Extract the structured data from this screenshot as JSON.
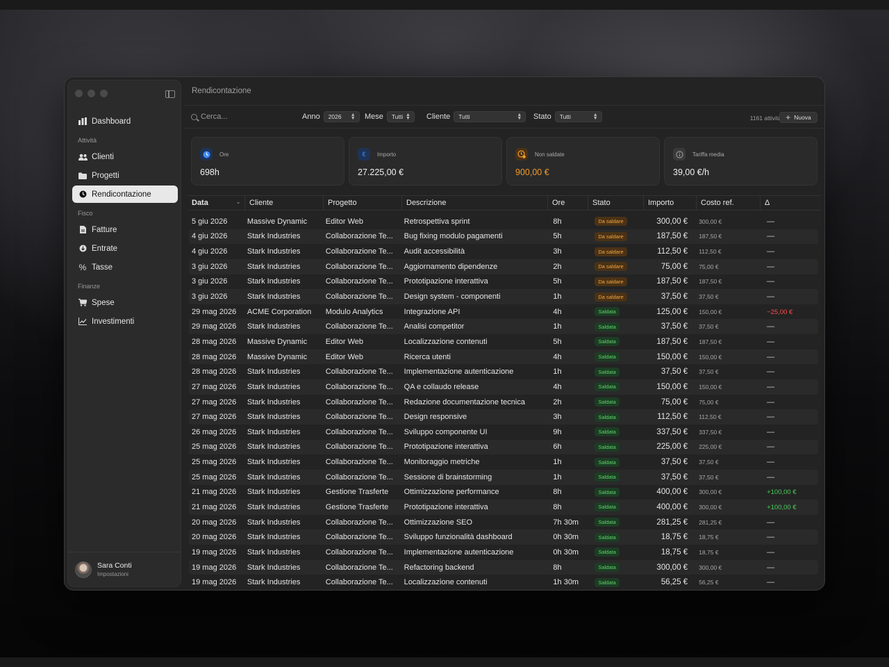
{
  "window": {
    "title": "Rendicontazione"
  },
  "sidebar": {
    "top_item": {
      "label": "Dashboard",
      "icon": "chart-bar-icon"
    },
    "sections": [
      {
        "title": "Attività",
        "items": [
          {
            "label": "Clienti",
            "icon": "users-icon",
            "active": false
          },
          {
            "label": "Progetti",
            "icon": "folder-icon",
            "active": false
          },
          {
            "label": "Rendicontazione",
            "icon": "clock-icon",
            "active": true
          }
        ]
      },
      {
        "title": "Fisco",
        "items": [
          {
            "label": "Fatture",
            "icon": "document-icon",
            "active": false
          },
          {
            "label": "Entrate",
            "icon": "arrow-down-circle-icon",
            "active": false
          },
          {
            "label": "Tasse",
            "icon": "percent-icon",
            "active": false
          }
        ]
      },
      {
        "title": "Finanze",
        "items": [
          {
            "label": "Spese",
            "icon": "cart-icon",
            "active": false
          },
          {
            "label": "Investimenti",
            "icon": "line-chart-icon",
            "active": false
          }
        ]
      }
    ],
    "user": {
      "name": "Sara Conti",
      "subtitle": "Impostazioni"
    }
  },
  "toolbar": {
    "search_placeholder": "Cerca...",
    "filters": {
      "anno": {
        "label": "Anno",
        "value": "2026"
      },
      "mese": {
        "label": "Mese",
        "value": "Tutti"
      },
      "cliente": {
        "label": "Cliente",
        "value": "Tutti"
      },
      "stato": {
        "label": "Stato",
        "value": "Tutti"
      }
    },
    "count": "1161 attività",
    "new_label": "Nuova"
  },
  "cards": [
    {
      "label": "Ore",
      "value": "698h",
      "icon": "clock-icon",
      "accent": "#3d8bff"
    },
    {
      "label": "Importo",
      "value": "27.225,00 €",
      "icon": "euro-icon",
      "accent": "#3d8bff"
    },
    {
      "label": "Non saldate",
      "value": "900,00 €",
      "icon": "clock-warning-icon",
      "accent": "#f39b2a"
    },
    {
      "label": "Tariffa media",
      "value": "39,00 €/h",
      "icon": "info-icon",
      "accent": "#9a9a9a"
    }
  ],
  "table": {
    "columns": [
      "Data",
      "Cliente",
      "Progetto",
      "Descrizione",
      "Ore",
      "Stato",
      "Importo",
      "Costo ref.",
      "Δ"
    ],
    "rows": [
      [
        "5 giu 2026",
        "Massive Dynamic",
        "Editor Web",
        "Retrospettiva sprint",
        "8h",
        "Da saldare",
        "300,00 €",
        "300,00 €",
        "—"
      ],
      [
        "4 giu 2026",
        "Stark Industries",
        "Collaborazione Te...",
        "Bug fixing modulo pagamenti",
        "5h",
        "Da saldare",
        "187,50 €",
        "187,50 €",
        "—"
      ],
      [
        "4 giu 2026",
        "Stark Industries",
        "Collaborazione Te...",
        "Audit accessibilità",
        "3h",
        "Da saldare",
        "112,50 €",
        "112,50 €",
        "—"
      ],
      [
        "3 giu 2026",
        "Stark Industries",
        "Collaborazione Te...",
        "Aggiornamento dipendenze",
        "2h",
        "Da saldare",
        "75,00 €",
        "75,00 €",
        "—"
      ],
      [
        "3 giu 2026",
        "Stark Industries",
        "Collaborazione Te...",
        "Prototipazione interattiva",
        "5h",
        "Da saldare",
        "187,50 €",
        "187,50 €",
        "—"
      ],
      [
        "3 giu 2026",
        "Stark Industries",
        "Collaborazione Te...",
        "Design system - componenti",
        "1h",
        "Da saldare",
        "37,50 €",
        "37,50 €",
        "—"
      ],
      [
        "29 mag 2026",
        "ACME Corporation",
        "Modulo Analytics",
        "Integrazione API",
        "4h",
        "Saldata",
        "125,00 €",
        "150,00 €",
        "−25,00 €"
      ],
      [
        "29 mag 2026",
        "Stark Industries",
        "Collaborazione Te...",
        "Analisi competitor",
        "1h",
        "Saldata",
        "37,50 €",
        "37,50 €",
        "—"
      ],
      [
        "28 mag 2026",
        "Massive Dynamic",
        "Editor Web",
        "Localizzazione contenuti",
        "5h",
        "Saldata",
        "187,50 €",
        "187,50 €",
        "—"
      ],
      [
        "28 mag 2026",
        "Massive Dynamic",
        "Editor Web",
        "Ricerca utenti",
        "4h",
        "Saldata",
        "150,00 €",
        "150,00 €",
        "—"
      ],
      [
        "28 mag 2026",
        "Stark Industries",
        "Collaborazione Te...",
        "Implementazione autenticazione",
        "1h",
        "Saldata",
        "37,50 €",
        "37,50 €",
        "—"
      ],
      [
        "27 mag 2026",
        "Stark Industries",
        "Collaborazione Te...",
        "QA e collaudo release",
        "4h",
        "Saldata",
        "150,00 €",
        "150,00 €",
        "—"
      ],
      [
        "27 mag 2026",
        "Stark Industries",
        "Collaborazione Te...",
        "Redazione documentazione tecnica",
        "2h",
        "Saldata",
        "75,00 €",
        "75,00 €",
        "—"
      ],
      [
        "27 mag 2026",
        "Stark Industries",
        "Collaborazione Te...",
        "Design responsive",
        "3h",
        "Saldata",
        "112,50 €",
        "112,50 €",
        "—"
      ],
      [
        "26 mag 2026",
        "Stark Industries",
        "Collaborazione Te...",
        "Sviluppo componente UI",
        "9h",
        "Saldata",
        "337,50 €",
        "337,50 €",
        "—"
      ],
      [
        "25 mag 2026",
        "Stark Industries",
        "Collaborazione Te...",
        "Prototipazione interattiva",
        "6h",
        "Saldata",
        "225,00 €",
        "225,00 €",
        "—"
      ],
      [
        "25 mag 2026",
        "Stark Industries",
        "Collaborazione Te...",
        "Monitoraggio metriche",
        "1h",
        "Saldata",
        "37,50 €",
        "37,50 €",
        "—"
      ],
      [
        "25 mag 2026",
        "Stark Industries",
        "Collaborazione Te...",
        "Sessione di brainstorming",
        "1h",
        "Saldata",
        "37,50 €",
        "37,50 €",
        "—"
      ],
      [
        "21 mag 2026",
        "Stark Industries",
        "Gestione Trasferte",
        "Ottimizzazione performance",
        "8h",
        "Saldata",
        "400,00 €",
        "300,00 €",
        "+100,00 €"
      ],
      [
        "21 mag 2026",
        "Stark Industries",
        "Gestione Trasferte",
        "Prototipazione interattiva",
        "8h",
        "Saldata",
        "400,00 €",
        "300,00 €",
        "+100,00 €"
      ],
      [
        "20 mag 2026",
        "Stark Industries",
        "Collaborazione Te...",
        "Ottimizzazione SEO",
        "7h 30m",
        "Saldata",
        "281,25 €",
        "281,25 €",
        "—"
      ],
      [
        "20 mag 2026",
        "Stark Industries",
        "Collaborazione Te...",
        "Sviluppo funzionalità dashboard",
        "0h 30m",
        "Saldata",
        "18,75 €",
        "18,75 €",
        "—"
      ],
      [
        "19 mag 2026",
        "Stark Industries",
        "Collaborazione Te...",
        "Implementazione autenticazione",
        "0h 30m",
        "Saldata",
        "18,75 €",
        "18,75 €",
        "—"
      ],
      [
        "19 mag 2026",
        "Stark Industries",
        "Collaborazione Te...",
        "Refactoring backend",
        "8h",
        "Saldata",
        "300,00 €",
        "300,00 €",
        "—"
      ],
      [
        "19 mag 2026",
        "Stark Industries",
        "Collaborazione Te...",
        "Localizzazione contenuti",
        "1h 30m",
        "Saldata",
        "56,25 €",
        "56,25 €",
        "—"
      ]
    ]
  },
  "colors": {
    "due_badge": "#f4a640",
    "paid_badge": "#5fd36a",
    "delta_negative": "#ff4d4d",
    "delta_positive": "#4ccf5c"
  }
}
